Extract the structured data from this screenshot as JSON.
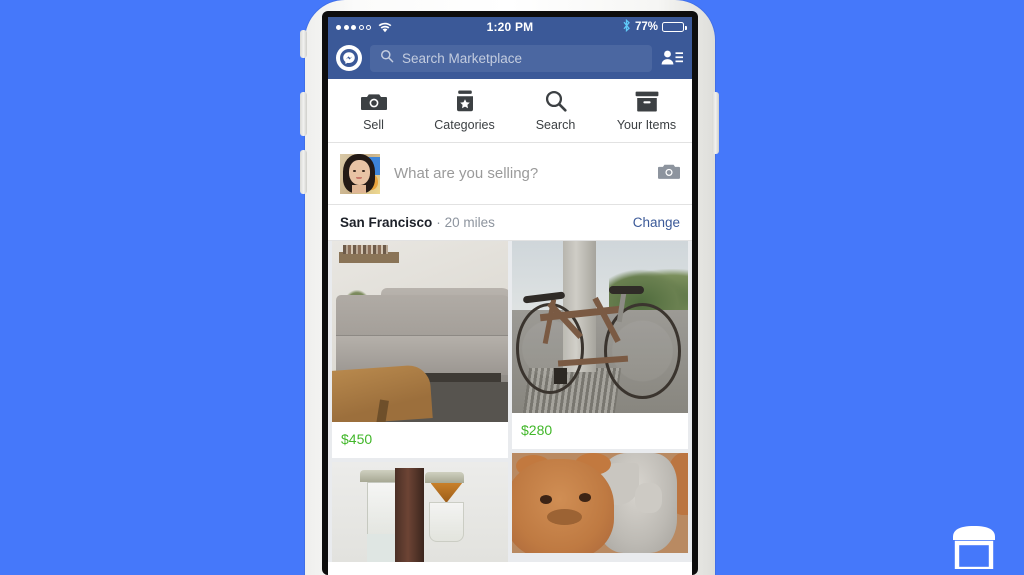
{
  "background": {
    "color": "#4578fa"
  },
  "device": {
    "name": "iphone-mockup",
    "buttons": [
      "silent-switch",
      "volume-up",
      "volume-down",
      "power"
    ]
  },
  "status_bar": {
    "signal_dots_filled": 3,
    "signal_dots_total": 5,
    "wifi": "wifi-icon",
    "time": "1:20 PM",
    "bluetooth": "bluetooth-icon",
    "battery_percent": "77%",
    "battery_level": 77,
    "background_color": "#3b5998"
  },
  "header": {
    "messenger_icon": "messenger-icon",
    "contacts_icon": "contacts-icon",
    "search": {
      "placeholder": "Search Marketplace",
      "icon": "search-icon"
    },
    "background_color": "#3b5998"
  },
  "tabs": [
    {
      "label": "Sell",
      "icon": "camera-icon"
    },
    {
      "label": "Categories",
      "icon": "categories-jar-icon"
    },
    {
      "label": "Search",
      "icon": "magnifier-icon"
    },
    {
      "label": "Your Items",
      "icon": "box-icon"
    }
  ],
  "composer": {
    "avatar": "user-avatar",
    "placeholder": "What are you selling?",
    "camera_icon": "camera-icon"
  },
  "location": {
    "city": "San Francisco",
    "separator": "·",
    "radius": "20 miles",
    "change_label": "Change",
    "change_color": "#3b5998"
  },
  "feed": {
    "price_color": "#42b72a",
    "columns": [
      {
        "items": [
          {
            "photo": "grey-tufted-sofa-living-room",
            "price": "$450"
          },
          {
            "photo": "glass-coffee-maker-carafe",
            "price": ""
          }
        ]
      },
      {
        "items": [
          {
            "photo": "brown-road-bicycle-by-pillar",
            "price": "$280"
          },
          {
            "photo": "plush-teddy-bear-and-elephant",
            "price": ""
          }
        ]
      }
    ]
  },
  "watermark": {
    "icon": "marketplace-storefront-icon",
    "color": "#ffffff"
  }
}
